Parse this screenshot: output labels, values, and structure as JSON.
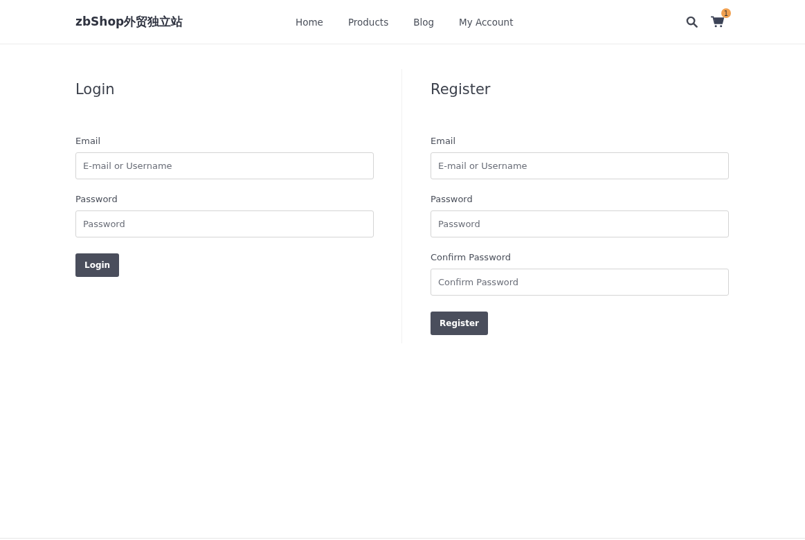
{
  "header": {
    "brand": "zbShop外贸独立站",
    "nav": [
      {
        "label": "Home"
      },
      {
        "label": "Products"
      },
      {
        "label": "Blog"
      },
      {
        "label": "My Account"
      }
    ],
    "cart_count": "1"
  },
  "forms": [
    {
      "title": "Login",
      "fields": [
        {
          "label": "Email",
          "placeholder": "E-mail or Username"
        },
        {
          "label": "Password",
          "placeholder": "Password"
        }
      ],
      "button": "Login"
    },
    {
      "title": "Register",
      "fields": [
        {
          "label": "Email",
          "placeholder": "E-mail or Username"
        },
        {
          "label": "Password",
          "placeholder": "Password"
        },
        {
          "label": "Confirm Password",
          "placeholder": "Confirm Password"
        }
      ],
      "button": "Register"
    }
  ]
}
